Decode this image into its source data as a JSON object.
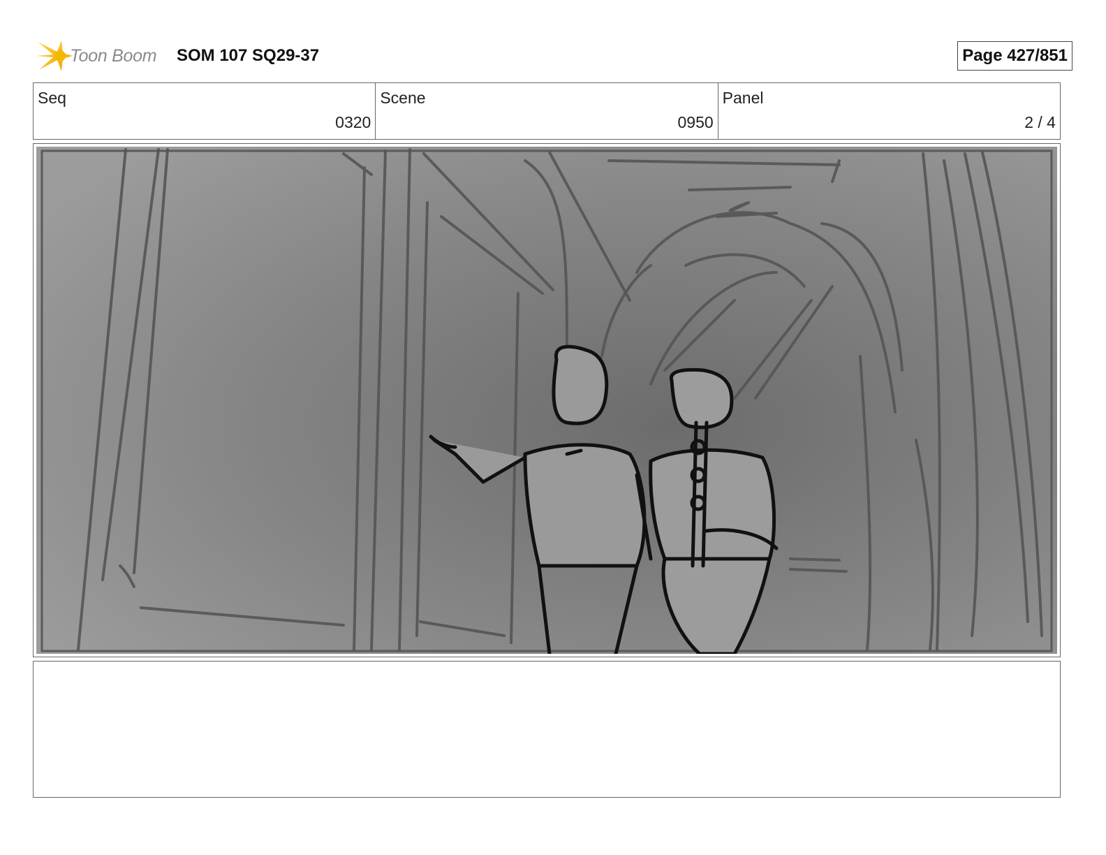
{
  "header": {
    "logo_text": "Toon Boom",
    "title": "SOM 107 SQ29-37",
    "page_indicator": "Page 427/851"
  },
  "info": {
    "seq_label": "Seq",
    "seq_value": "0320",
    "scene_label": "Scene",
    "scene_value": "0950",
    "panel_label": "Panel",
    "panel_value": "2 / 4"
  },
  "panel_image": {
    "icon": "storyboard-sketch-two-figures-in-arched-corridor"
  },
  "notes": {
    "text": ""
  },
  "colors": {
    "logo_star": "#f5b800",
    "logo_text": "#8a8a8a",
    "border": "#666666",
    "sketch_background": "#8c8c8c"
  }
}
